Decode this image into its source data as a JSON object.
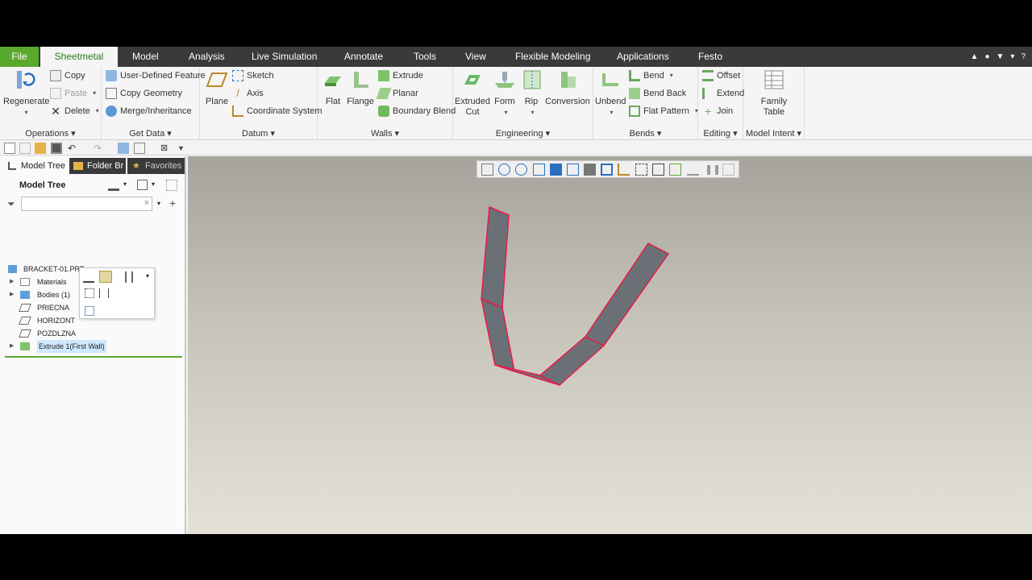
{
  "tabs": {
    "file": "File",
    "items": [
      "Sheetmetal",
      "Model",
      "Analysis",
      "Live Simulation",
      "Annotate",
      "Tools",
      "View",
      "Flexible Modeling",
      "Applications",
      "Festo"
    ]
  },
  "ribbon": {
    "operations": {
      "label": "Operations",
      "regenerate": "Regenerate",
      "copy": "Copy",
      "paste": "Paste",
      "delete": "Delete"
    },
    "get_data": {
      "label": "Get Data",
      "udf": "User-Defined Feature",
      "copy_geometry": "Copy Geometry",
      "merge": "Merge/Inheritance"
    },
    "datum": {
      "label": "Datum",
      "plane": "Plane",
      "sketch": "Sketch",
      "axis": "Axis",
      "csys": "Coordinate System"
    },
    "walls": {
      "label": "Walls",
      "flat": "Flat",
      "flange": "Flange",
      "extrude": "Extrude",
      "planar": "Planar",
      "boundary_blend": "Boundary Blend"
    },
    "engineering": {
      "label": "Engineering",
      "extruded_cut_1": "Extruded",
      "extruded_cut_2": "Cut",
      "form": "Form",
      "rip": "Rip",
      "conversion": "Conversion"
    },
    "bends": {
      "label": "Bends",
      "unbend": "Unbend",
      "bend": "Bend",
      "bend_back": "Bend Back",
      "flat_pattern": "Flat Pattern"
    },
    "editing": {
      "label": "Editing",
      "offset": "Offset",
      "extend": "Extend",
      "join": "Join"
    },
    "model_intent": {
      "label": "Model Intent",
      "family_table_1": "Family",
      "family_table_2": "Table"
    }
  },
  "left_panel": {
    "tabs": [
      "Model Tree",
      "Folder Br",
      "Favorites"
    ],
    "title": "Model Tree",
    "tree": [
      {
        "label": "BRACKET-01.PRT",
        "icon": "part-icon"
      },
      {
        "label": "Materials",
        "icon": "folder-icon"
      },
      {
        "label": "Bodies (1)",
        "icon": "body-icon"
      },
      {
        "label": "PRIECNA",
        "icon": "datum-plane-icon"
      },
      {
        "label": "HORIZONT",
        "icon": "datum-plane-icon"
      },
      {
        "label": "POZDLZNA",
        "icon": "datum-plane-icon"
      },
      {
        "label": "Extrude 1(First Wall)",
        "icon": "first-wall-icon"
      }
    ]
  },
  "colors": {
    "file_tab": "#5ba82e",
    "active_tab_text": "#2b7a1a",
    "part_fill": "#6b7077",
    "part_edge": "#e8194a",
    "selection": "#cfe8ff"
  }
}
